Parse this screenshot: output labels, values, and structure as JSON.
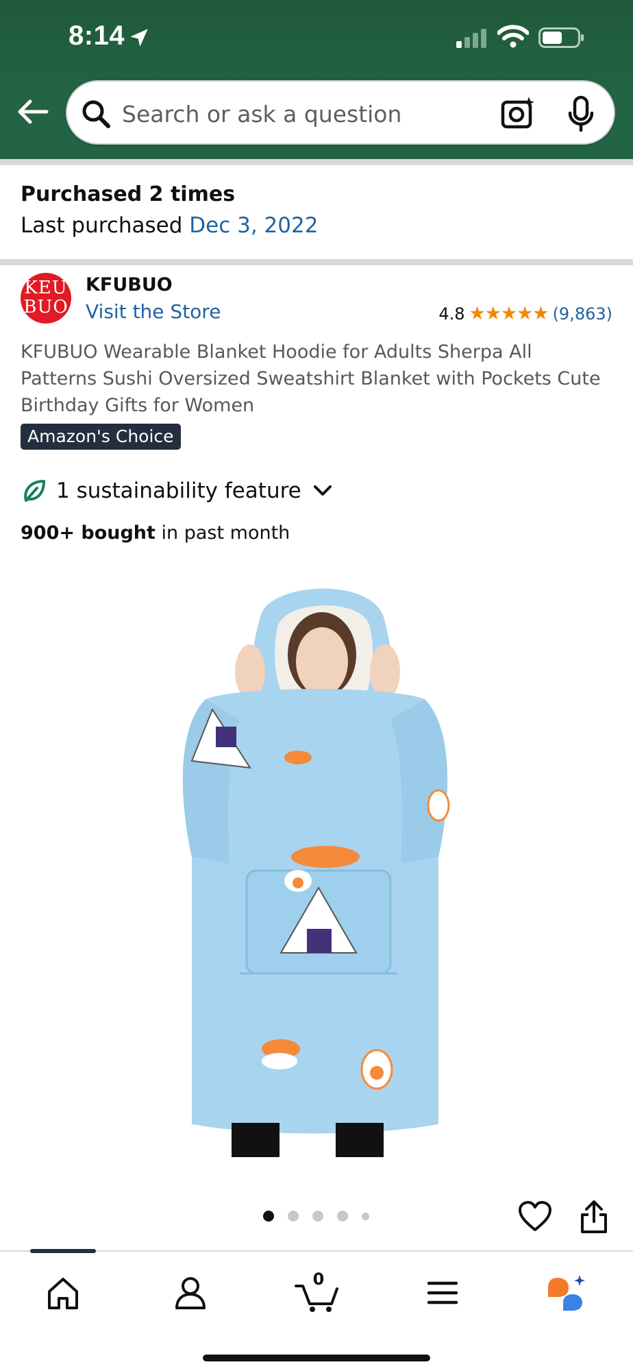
{
  "status_bar": {
    "time": "8:14"
  },
  "search": {
    "placeholder": "Search or ask a question"
  },
  "purchase_history": {
    "title": "Purchased 2 times",
    "last_label": "Last purchased",
    "last_date": "Dec 3, 2022"
  },
  "brand": {
    "logo_text_line1": "KEU",
    "logo_text_line2": "BUO",
    "name": "KFUBUO",
    "store_link": "Visit the Store"
  },
  "rating": {
    "value": "4.8",
    "stars": "★★★★★",
    "count": "(9,863)"
  },
  "product": {
    "title": "KFUBUO Wearable Blanket Hoodie for Adults Sherpa All Patterns Sushi Oversized Sweatshirt Blanket with Pockets Cute Birthday Gifts for Women",
    "badge": "Amazon's Choice",
    "sustainability": "1 sustainability feature",
    "bought_strong": "900+ bought",
    "bought_rest": " in past month",
    "image_count": 5,
    "active_image_index": 0
  },
  "cart": {
    "count": "0"
  },
  "colors": {
    "header_green": "#236443",
    "link_blue": "#2162a1",
    "star_orange": "#f08804",
    "badge_navy": "#232f3e",
    "product_blue": "#a9d4ef"
  },
  "icons": {
    "back": "back-arrow-icon",
    "search": "search-icon",
    "camera": "camera-icon",
    "mic": "microphone-icon",
    "leaf": "leaf-icon",
    "heart": "heart-icon",
    "share": "share-icon",
    "home": "home-icon",
    "account": "account-icon",
    "cart": "cart-icon",
    "menu": "menu-icon",
    "rufus": "rufus-icon"
  }
}
